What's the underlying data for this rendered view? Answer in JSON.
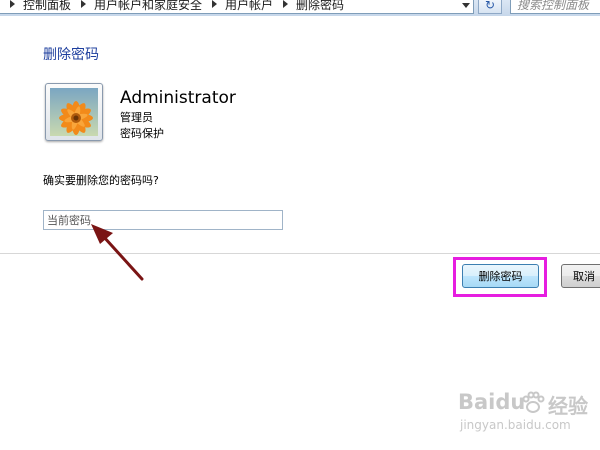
{
  "address_bar": {
    "breadcrumbs": [
      "控制面板",
      "用户帐户和家庭安全",
      "用户帐户",
      "删除密码"
    ],
    "search_placeholder": "搜索控制面板"
  },
  "page": {
    "title": "删除密码",
    "user": {
      "name": "Administrator",
      "role": "管理员",
      "status": "密码保护"
    },
    "question": "确实要删除您的密码吗?",
    "password_field": {
      "placeholder": "当前密码",
      "value": ""
    }
  },
  "buttons": {
    "delete": "删除密码",
    "cancel": "取消"
  },
  "annotation": {
    "highlight_color": "#e61ee0",
    "arrow_color": "#7a1414"
  },
  "watermark": {
    "brand": "Baidu",
    "text": "经验",
    "url": "jingyan.baidu.com"
  },
  "icons": [
    "chevron-down-icon",
    "refresh-icon",
    "arrow-annotation-icon",
    "paw-icon"
  ]
}
